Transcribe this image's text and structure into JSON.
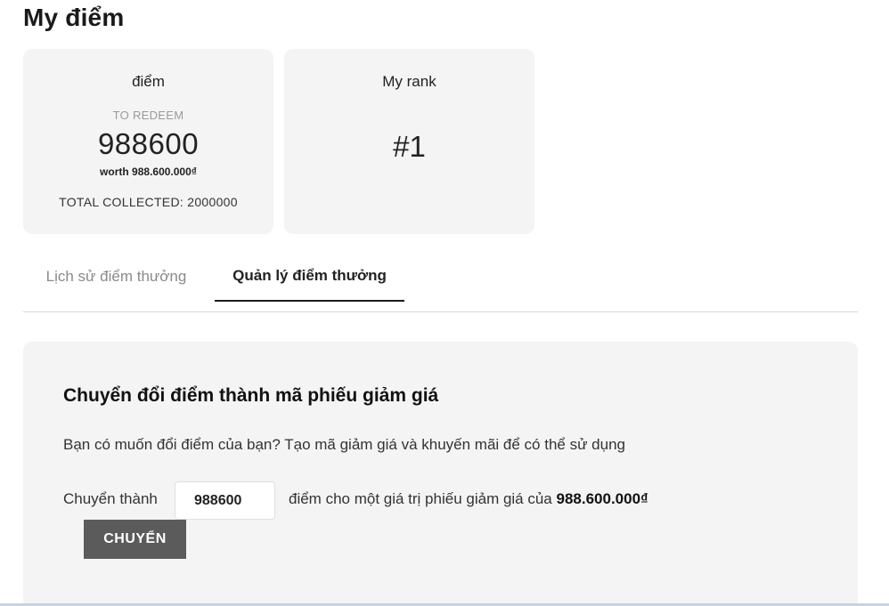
{
  "page": {
    "title": "My điểm"
  },
  "points_card": {
    "title": "điểm",
    "redeem_label": "TO REDEEM",
    "value": "988600",
    "worth": "worth 988.600.000₫",
    "total_collected": "TOTAL COLLECTED: 2000000"
  },
  "rank_card": {
    "title": "My rank",
    "value": "#1"
  },
  "tabs": [
    {
      "label": "Lịch sử điểm thưởng",
      "active": false
    },
    {
      "label": "Quản lý điểm thưởng",
      "active": true
    }
  ],
  "convert": {
    "title": "Chuyển đổi điểm thành mã phiếu giảm giá",
    "description": "Bạn có muốn đổi điểm của bạn? Tạo mã giảm giá và khuyến mãi để có thể sử dụng",
    "prefix": "Chuyển thành",
    "input_value": "988600",
    "suffix": "điểm cho một giá trị phiếu giảm giá của ",
    "amount": "988.600.000₫",
    "button_label": "CHUYỂN"
  },
  "colors": {
    "card_background": "#f4f4f4",
    "button_background": "#5b5b5b",
    "active_tab_underline": "#1a1a1a"
  }
}
